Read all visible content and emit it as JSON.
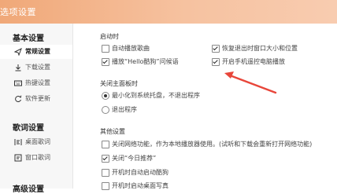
{
  "window": {
    "title": "选项设置"
  },
  "sidebar": {
    "categories": [
      {
        "title": "基本设置",
        "items": [
          {
            "label": "常规设置",
            "icon": "paper-plane-icon",
            "active": true
          },
          {
            "label": "下载设置",
            "icon": "download-icon",
            "active": false
          },
          {
            "label": "热键设置",
            "icon": "keyboard-icon",
            "active": false
          },
          {
            "label": "软件更新",
            "icon": "refresh-icon",
            "active": false
          }
        ]
      },
      {
        "title": "歌词设置",
        "items": [
          {
            "label": "桌面歌词",
            "icon": "desktop-lyrics-icon",
            "active": false
          },
          {
            "label": "窗口歌词",
            "icon": "window-lyrics-icon",
            "active": false
          }
        ]
      },
      {
        "title": "高级设置",
        "items": []
      }
    ]
  },
  "sections": {
    "startup": {
      "title": "启动时",
      "options": [
        {
          "label": "自动播放歌曲",
          "checked": false
        },
        {
          "label": "恢复退出时窗口大小和位置",
          "checked": true
        },
        {
          "label": "播放“Hello酷狗”问候语",
          "checked": true
        },
        {
          "label": "开启手机遥控电脑播放",
          "checked": true
        }
      ]
    },
    "close_panel": {
      "title": "关闭主面板时",
      "options": [
        {
          "label": "最小化到系统托盘，不退出程序",
          "selected": true
        },
        {
          "label": "退出程序",
          "selected": false
        }
      ]
    },
    "other": {
      "title": "其他设置",
      "options": [
        {
          "label": "关闭网络功能，作为本地播放器使用。(试听和下载会重新打开网络功能)",
          "checked": false
        },
        {
          "label": "关闭“今日推荐”",
          "checked": true
        },
        {
          "label": "开机时自动启动酷狗",
          "checked": false
        },
        {
          "label": "开机时启动桌面写真",
          "checked": false
        }
      ]
    }
  },
  "annotation": {
    "arrow_color": "#e8463a"
  }
}
